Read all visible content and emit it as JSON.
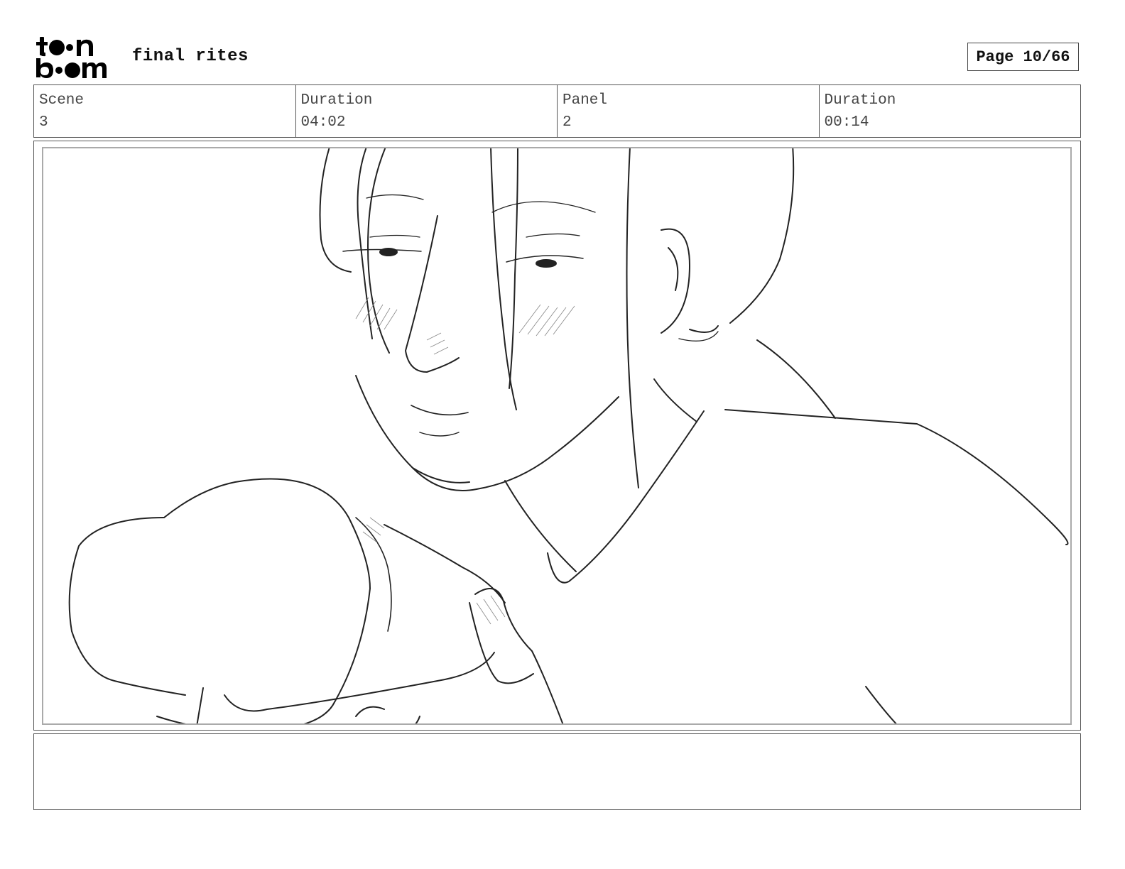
{
  "header": {
    "logo_text_line1": "toon",
    "logo_text_line2": "boom",
    "project_title": "final rites",
    "page_indicator": "Page 10/66"
  },
  "info": [
    {
      "label": "Scene",
      "value": "3"
    },
    {
      "label": "Duration",
      "value": "04:02"
    },
    {
      "label": "Panel",
      "value": "2"
    },
    {
      "label": "Duration",
      "value": "00:14"
    }
  ],
  "panel": {
    "description": ""
  },
  "notes": {
    "text": ""
  }
}
